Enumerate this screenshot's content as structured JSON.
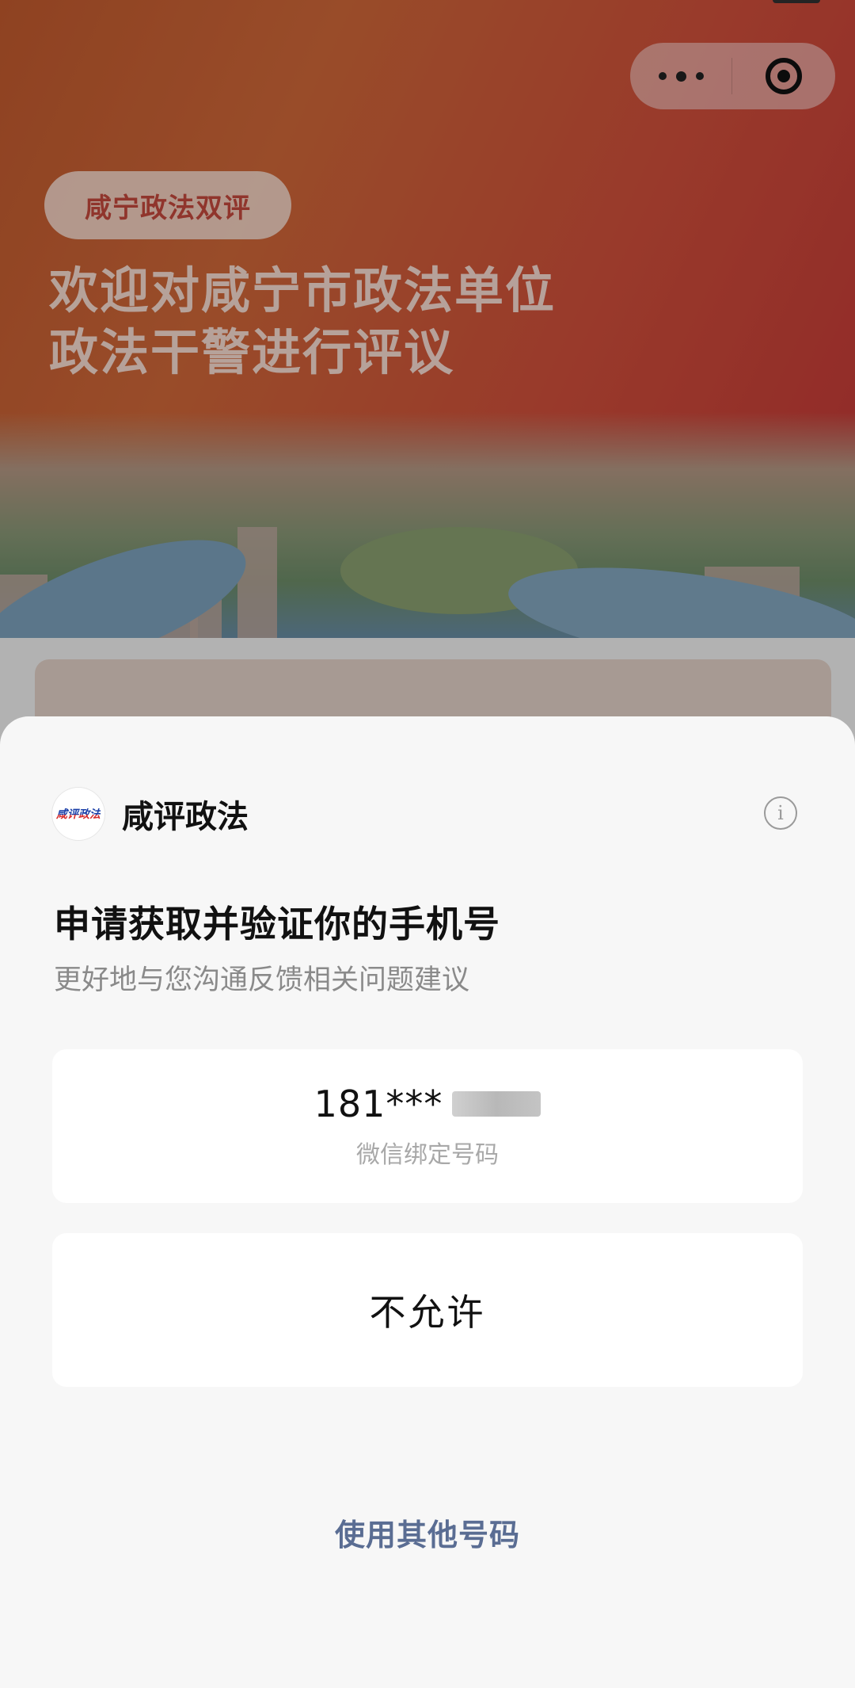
{
  "background": {
    "tag": "咸宁政法双评",
    "headline_line1": "欢迎对咸宁市政法单位",
    "headline_line2": "政法干警进行评议"
  },
  "capsule": {
    "more_icon": "more-dots-icon",
    "close_icon": "target-close-icon"
  },
  "sheet": {
    "app_name": "咸评政法",
    "app_logo_text": "咸评政法",
    "info_icon": "info-icon",
    "title": "申请获取并验证你的手机号",
    "subtitle": "更好地与您沟通反馈相关问题建议",
    "phone_option": {
      "number": "181***",
      "label": "微信绑定号码"
    },
    "deny_option": {
      "label": "不允许"
    },
    "other_number_link": "使用其他号码"
  },
  "colors": {
    "accent_link": "#5a6d93",
    "banner_start": "#c65c2f",
    "banner_end": "#c83838"
  }
}
